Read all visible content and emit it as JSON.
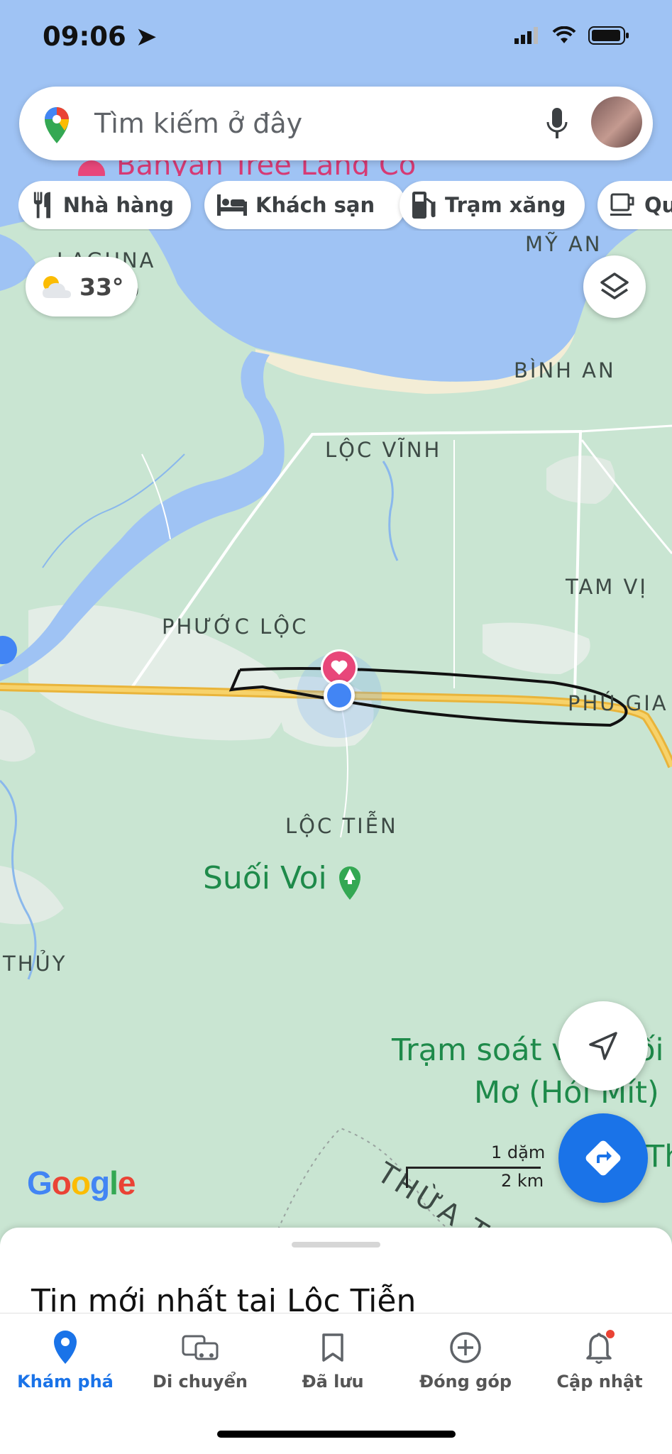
{
  "status_bar": {
    "time": "09:06"
  },
  "search": {
    "placeholder": "Tìm kiếm ở đây"
  },
  "chips": [
    {
      "label": "Nhà hàng",
      "icon": "restaurant-icon"
    },
    {
      "label": "Khách sạn",
      "icon": "hotel-icon"
    },
    {
      "label": "Trạm xăng",
      "icon": "gas-station-icon"
    },
    {
      "label": "Qu",
      "icon": "coffee-icon"
    }
  ],
  "weather": {
    "temp": "33°"
  },
  "map": {
    "poi_top": "Banyan Tree Lăng Cô",
    "places": [
      "LAGUNA",
      "CÔ",
      "MỸ AN",
      "BÌNH AN",
      "LỘC VĨNH",
      "TAM VỊ",
      "PHƯỚC LỘC",
      "PHÚ GIA",
      "LỘC TIỄN",
      "THỦY"
    ],
    "parks": [
      "Suối Voi"
    ],
    "checkpoint": [
      "Trạm soát vé Suối",
      "Mơ (Hói Mít)"
    ],
    "province": "THỪA THIÊN HUẾ",
    "edge_text": "Th",
    "scale": {
      "miles": "1 dặm",
      "km": "2 km"
    },
    "google": [
      "G",
      "o",
      "o",
      "g",
      "l",
      "e"
    ],
    "colors": {
      "water": "#9fc3f4",
      "land": "#c8e4d1",
      "road": "#f2c04d",
      "accent": "#1a73e8"
    }
  },
  "sheet": {
    "title": "Tin mới nhất tại Lộc Tiễn"
  },
  "tabs": [
    {
      "label": "Khám phá",
      "active": true
    },
    {
      "label": "Di chuyển"
    },
    {
      "label": "Đã lưu"
    },
    {
      "label": "Đóng góp"
    },
    {
      "label": "Cập nhật"
    }
  ]
}
